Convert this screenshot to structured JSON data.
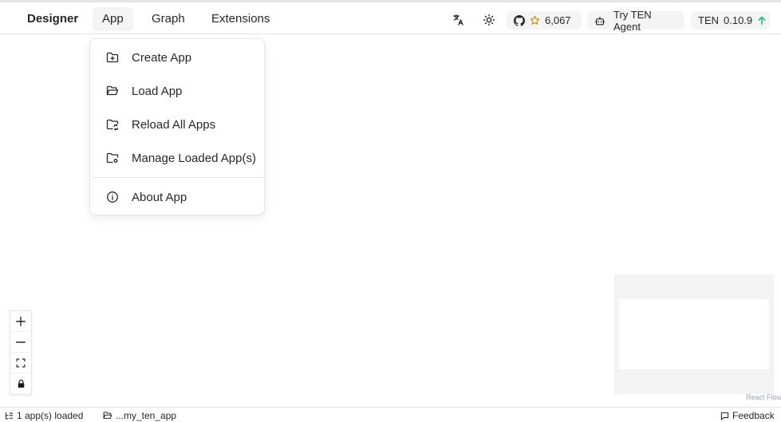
{
  "header": {
    "brand": "Designer",
    "menus": [
      {
        "label": "App"
      },
      {
        "label": "Graph"
      },
      {
        "label": "Extensions"
      }
    ],
    "github_stars": "6,067",
    "try_agent_label": "Try TEN Agent",
    "version_prefix": "TEN",
    "version": "0.10.9"
  },
  "app_menu": {
    "items": [
      {
        "label": "Create App",
        "icon": "folder-plus-icon"
      },
      {
        "label": "Load App",
        "icon": "folder-open-icon"
      },
      {
        "label": "Reload All Apps",
        "icon": "folder-sync-icon"
      },
      {
        "label": "Manage Loaded App(s)",
        "icon": "folder-cog-icon"
      },
      {
        "label": "About App",
        "icon": "info-icon"
      }
    ]
  },
  "canvas": {
    "attribution": "React Flow"
  },
  "status": {
    "apps_loaded": "1 app(s) loaded",
    "app_path": "...my_ten_app",
    "feedback": "Feedback"
  },
  "colors": {
    "accent_up": "#10b981",
    "star": "#ca8a04"
  }
}
